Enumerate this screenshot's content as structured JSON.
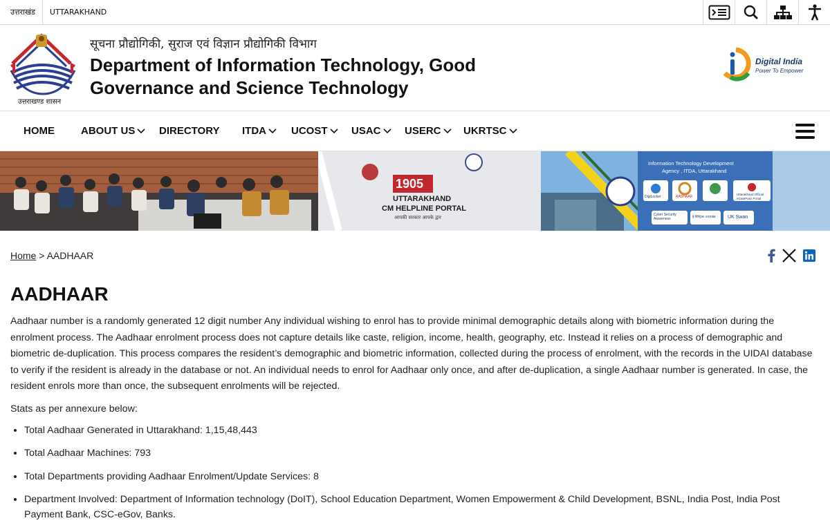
{
  "topbar": {
    "lang_hindi": "उत्तराखंड",
    "lang_english": "UTTARAKHAND"
  },
  "header": {
    "emblem_caption": "उत्तराखण्ड शासन",
    "title_hindi": "सूचना प्रौद्योगिकी, सुराज एवं विज्ञान प्रौद्योगिकी विभाग",
    "title_english": "Department of Information Technology, Good Governance and Science Technology",
    "digital_india_title": "Digital India",
    "digital_india_tagline": "Power To Empower"
  },
  "nav": {
    "items": [
      {
        "label": "HOME",
        "dropdown": false
      },
      {
        "label": "ABOUT US",
        "dropdown": true
      },
      {
        "label": "DIRECTORY",
        "dropdown": false
      },
      {
        "label": "ITDA",
        "dropdown": true
      },
      {
        "label": "UCOST",
        "dropdown": true
      },
      {
        "label": "USAC",
        "dropdown": true
      },
      {
        "label": "USERC",
        "dropdown": true
      },
      {
        "label": "UKRTSC",
        "dropdown": true
      }
    ]
  },
  "banner": {
    "helpline_number": "1905",
    "helpline_line1": "UTTARAKHAND",
    "helpline_line2": "CM HELPLINE PORTAL",
    "helpline_tag": "आपकी सरकार आपके द्वार",
    "agency_line1": "Information Technology Development",
    "agency_line2": "Agency , ITDA, Uttarakhand",
    "tiles": [
      "DigiLocker",
      "AADHAAR",
      "",
      "Uttarakhand Official eGatePass Portal"
    ],
    "tiles2": [
      "Cyber Security Awareness",
      "ई-डिस्ट्रिक्ट उत्तराखंड",
      "UK Swan"
    ]
  },
  "breadcrumb": {
    "home": "Home",
    "separator": ">",
    "current": "AADHAAR"
  },
  "page": {
    "title": "AADHAAR",
    "description": "Aadhaar number is a randomly generated 12 digit number Any individual wishing to enrol has to provide minimal demographic details along with biometric information during the enrolment process. The Aadhaar enrolment process does not capture details like caste, religion, income, health, geography, etc. Instead it relies on a process of demographic and biometric de-duplication. This process compares the resident’s demographic and biometric information, collected during the process of enrolment, with the records in the UIDAI database to verify if the resident is already in the database or not. An individual needs to enrol for Aadhaar only once, and after de-duplication, a single Aadhaar number is generated. In case, the resident enrols more than once, the subsequent enrolments will be rejected.",
    "stats_intro": "Stats as per annexure below:",
    "stats": [
      "Total Aadhaar Generated in Uttarakhand: 1,15,48,443",
      "Total Aadhaar Machines: 793",
      "Total Departments providing Aadhaar Enrolment/Update Services: 8",
      "Department Involved: Department of Information technology (DoIT), School Education Department, Women Empowerment & Child Development, BSNL, India Post, India Post Payment Bank, CSC-eGov, Banks."
    ]
  },
  "colors": {
    "facebook": "#3b5998",
    "linkedin": "#0a66c2",
    "text": "#222222",
    "border": "#d9d9d9"
  },
  "icons": [
    "content-skip-icon",
    "search-icon",
    "sitemap-icon",
    "accessibility-icon",
    "chevron-down-icon",
    "hamburger-menu-icon",
    "facebook-icon",
    "x-icon",
    "linkedin-icon"
  ]
}
